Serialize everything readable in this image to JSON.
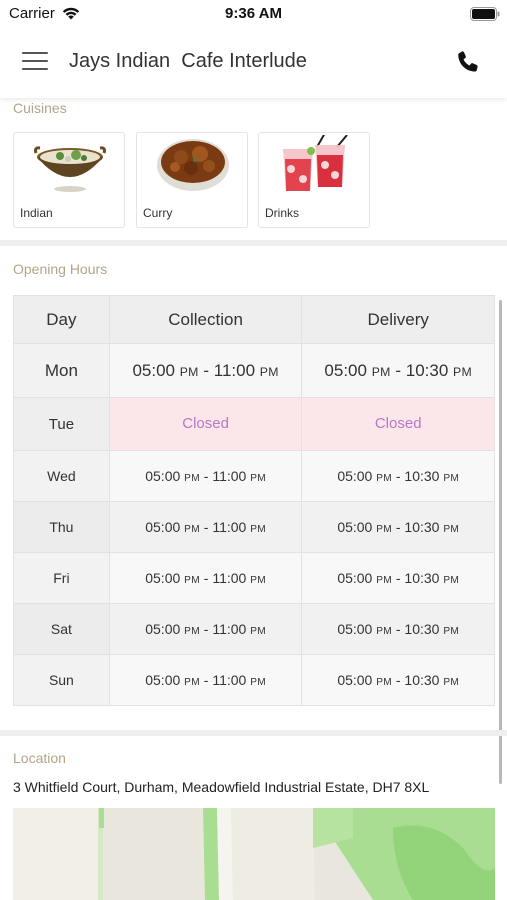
{
  "status_bar": {
    "carrier": "Carrier",
    "time": "9:36 AM"
  },
  "header": {
    "title": "Jays Indian  Cafe Interlude",
    "menu_icon": "hamburger-menu-icon",
    "phone_icon": "phone-icon"
  },
  "cuisines": {
    "label": "Cuisines",
    "items": [
      {
        "label": "Indian"
      },
      {
        "label": "Curry"
      },
      {
        "label": "Drinks"
      }
    ]
  },
  "opening_hours": {
    "label": "Opening Hours",
    "headers": {
      "day": "Day",
      "collection": "Collection",
      "delivery": "Delivery"
    },
    "rows": [
      {
        "day": "Mon",
        "collection_from": "05:00",
        "collection_from_ampm": "PM",
        "collection_sep": " - ",
        "collection_to": "11:00",
        "collection_to_ampm": "PM",
        "delivery_from": "05:00",
        "delivery_from_ampm": "PM",
        "delivery_sep": " - ",
        "delivery_to": "10:30",
        "delivery_to_ampm": "PM"
      },
      {
        "day": "Tue",
        "collection": "Closed",
        "delivery": "Closed"
      },
      {
        "day": "Wed",
        "collection_from": "05:00",
        "collection_from_ampm": "PM",
        "collection_sep": " - ",
        "collection_to": "11:00",
        "collection_to_ampm": "PM",
        "delivery_from": "05:00",
        "delivery_from_ampm": "PM",
        "delivery_sep": " - ",
        "delivery_to": "10:30",
        "delivery_to_ampm": "PM"
      },
      {
        "day": "Thu",
        "collection_from": "05:00",
        "collection_from_ampm": "PM",
        "collection_sep": " - ",
        "collection_to": "11:00",
        "collection_to_ampm": "PM",
        "delivery_from": "05:00",
        "delivery_from_ampm": "PM",
        "delivery_sep": " - ",
        "delivery_to": "10:30",
        "delivery_to_ampm": "PM"
      },
      {
        "day": "Fri",
        "collection_from": "05:00",
        "collection_from_ampm": "PM",
        "collection_sep": " - ",
        "collection_to": "11:00",
        "collection_to_ampm": "PM",
        "delivery_from": "05:00",
        "delivery_from_ampm": "PM",
        "delivery_sep": " - ",
        "delivery_to": "10:30",
        "delivery_to_ampm": "PM"
      },
      {
        "day": "Sat",
        "collection_from": "05:00",
        "collection_from_ampm": "PM",
        "collection_sep": " - ",
        "collection_to": "11:00",
        "collection_to_ampm": "PM",
        "delivery_from": "05:00",
        "delivery_from_ampm": "PM",
        "delivery_sep": " - ",
        "delivery_to": "10:30",
        "delivery_to_ampm": "PM"
      },
      {
        "day": "Sun",
        "collection_from": "05:00",
        "collection_from_ampm": "PM",
        "collection_sep": " - ",
        "collection_to": "11:00",
        "collection_to_ampm": "PM",
        "delivery_from": "05:00",
        "delivery_from_ampm": "PM",
        "delivery_sep": " - ",
        "delivery_to": "10:30",
        "delivery_to_ampm": "PM"
      }
    ]
  },
  "location": {
    "label": "Location",
    "address": "3 Whitfield Court, Durham, Meadowfield Industrial Estate, DH7 8XL"
  },
  "colors": {
    "section_label": "#b3a48a",
    "closed_text": "#b777c8",
    "closed_bg": "#fbe7ea",
    "map_green": "#a9dd91"
  }
}
